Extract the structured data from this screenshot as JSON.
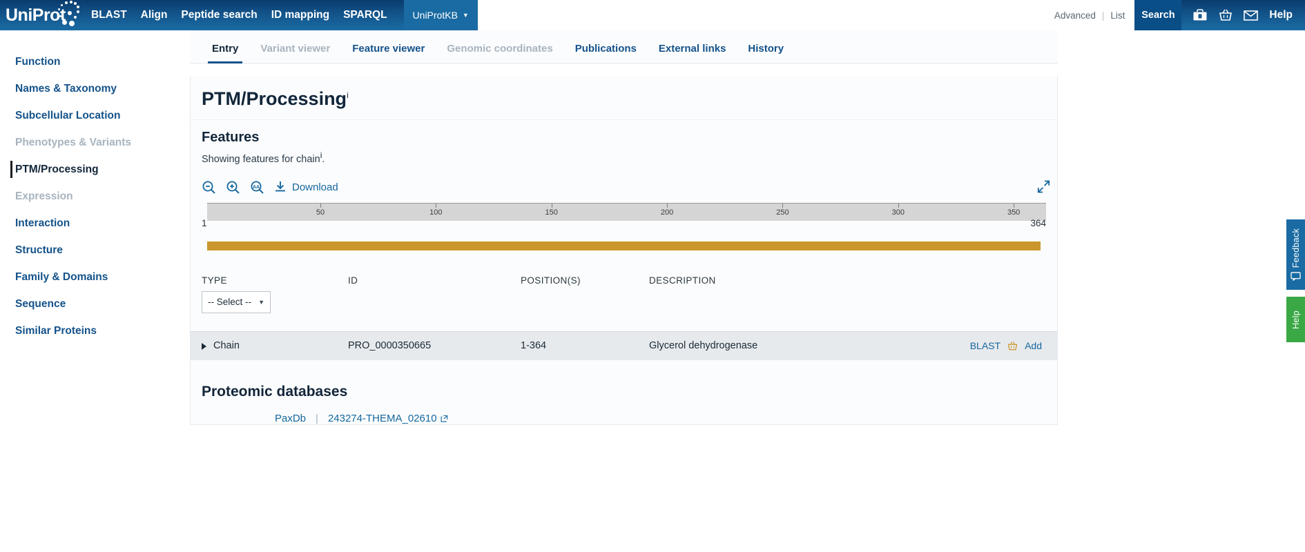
{
  "header": {
    "logo_text": "UniProt",
    "nav": [
      {
        "label": "BLAST"
      },
      {
        "label": "Align"
      },
      {
        "label": "Peptide search"
      },
      {
        "label": "ID mapping"
      },
      {
        "label": "SPARQL"
      }
    ],
    "kb_selected": "UniProtKB",
    "search_value": "",
    "search_placeholder": "",
    "advanced_label": "Advanced",
    "list_label": "List",
    "divider": "|",
    "search_button": "Search",
    "help_label": "Help",
    "icons": [
      "toolbox-icon",
      "basket-icon",
      "envelope-icon"
    ]
  },
  "sidebar": {
    "items": [
      {
        "label": "Function",
        "state": "enabled"
      },
      {
        "label": "Names & Taxonomy",
        "state": "enabled"
      },
      {
        "label": "Subcellular Location",
        "state": "enabled"
      },
      {
        "label": "Phenotypes & Variants",
        "state": "disabled"
      },
      {
        "label": "PTM/Processing",
        "state": "active"
      },
      {
        "label": "Expression",
        "state": "disabled"
      },
      {
        "label": "Interaction",
        "state": "enabled"
      },
      {
        "label": "Structure",
        "state": "enabled"
      },
      {
        "label": "Family & Domains",
        "state": "enabled"
      },
      {
        "label": "Sequence",
        "state": "enabled"
      },
      {
        "label": "Similar Proteins",
        "state": "enabled"
      }
    ]
  },
  "tabs": [
    {
      "label": "Entry",
      "state": "active"
    },
    {
      "label": "Variant viewer",
      "state": "disabled"
    },
    {
      "label": "Feature viewer",
      "state": "enabled"
    },
    {
      "label": "Genomic coordinates",
      "state": "disabled"
    },
    {
      "label": "Publications",
      "state": "enabled"
    },
    {
      "label": "External links",
      "state": "enabled"
    },
    {
      "label": "History",
      "state": "enabled"
    }
  ],
  "page": {
    "title": "PTM/Processing",
    "title_sup": "i"
  },
  "features": {
    "heading": "Features",
    "subtitle": "Showing features for chain",
    "subtitle_sup": "i",
    "subtitle_end": ".",
    "toolbar": {
      "zoom_out": "zoom-out-icon",
      "zoom_in": "zoom-in-icon",
      "zoom_aa": "zoom-amino-acid-icon",
      "download_icon": "download-icon",
      "download_label": "Download",
      "expand_icon": "expand-icon"
    },
    "ruler": {
      "start": "1",
      "end": "364",
      "ticks": [
        {
          "label": "50",
          "value": 50
        },
        {
          "label": "100",
          "value": 100
        },
        {
          "label": "150",
          "value": 150
        },
        {
          "label": "200",
          "value": 200
        },
        {
          "label": "250",
          "value": 250
        },
        {
          "label": "300",
          "value": 300
        },
        {
          "label": "350",
          "value": 350
        }
      ],
      "min": 1,
      "max": 364
    },
    "track": {
      "name": "chain-track",
      "color": "#c9972b",
      "start": 1,
      "end": 364
    },
    "table": {
      "columns": [
        "TYPE",
        "ID",
        "POSITION(S)",
        "DESCRIPTION"
      ],
      "type_filter": {
        "selected": "-- Select --",
        "caret": "▼"
      },
      "rows": [
        {
          "type": "Chain",
          "id": "PRO_0000350665",
          "positions": "1-364",
          "description": "Glycerol dehydrogenase",
          "blast_label": "BLAST",
          "add_label": "Add"
        }
      ]
    }
  },
  "proteomic": {
    "heading": "Proteomic databases",
    "rows": [
      {
        "db": "PaxDb",
        "separator": "|",
        "value": "243274-THEMA_02610"
      }
    ]
  },
  "side_tabs": {
    "feedback": "Feedback",
    "help": "Help"
  },
  "colors": {
    "header_blue": "#14588f",
    "link_blue": "#14679d",
    "chain_gold": "#c9972b",
    "help_green": "#3aa845"
  }
}
